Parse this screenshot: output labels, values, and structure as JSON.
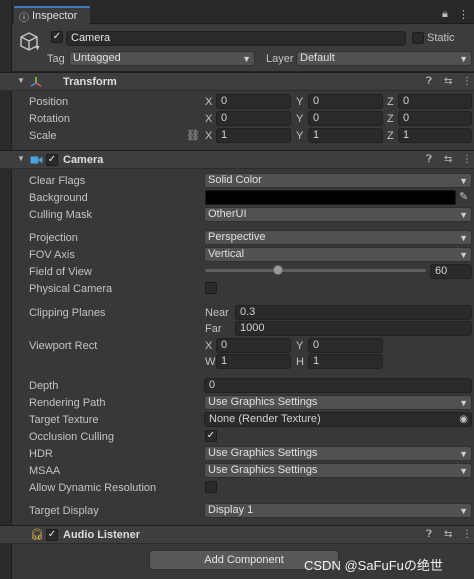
{
  "tab": {
    "title": "Inspector"
  },
  "object": {
    "name": "Camera",
    "static_label": "Static",
    "tag_label": "Tag",
    "tag_value": "Untagged",
    "layer_label": "Layer",
    "layer_value": "Default"
  },
  "transform": {
    "title": "Transform",
    "position_label": "Position",
    "rotation_label": "Rotation",
    "scale_label": "Scale",
    "x": "X",
    "y": "Y",
    "z": "Z",
    "position": [
      "0",
      "0",
      "0"
    ],
    "rotation": [
      "0",
      "0",
      "0"
    ],
    "scale": [
      "1",
      "1",
      "1"
    ]
  },
  "camera": {
    "title": "Camera",
    "clear_flags_label": "Clear Flags",
    "clear_flags": "Solid Color",
    "background_label": "Background",
    "background_color": "#000000",
    "culling_mask_label": "Culling Mask",
    "culling_mask": "OtherUI",
    "projection_label": "Projection",
    "projection": "Perspective",
    "fov_axis_label": "FOV Axis",
    "fov_axis": "Vertical",
    "fov_label": "Field of View",
    "fov": "60",
    "fov_fraction": 0.33,
    "physical_camera_label": "Physical Camera",
    "clipping_label": "Clipping Planes",
    "near_label": "Near",
    "near": "0.3",
    "far_label": "Far",
    "far": "1000",
    "viewport_label": "Viewport Rect",
    "vx": "0",
    "vy": "0",
    "vw": "1",
    "vh": "1",
    "vx_label": "X",
    "vy_label": "Y",
    "vw_label": "W",
    "vh_label": "H",
    "depth_label": "Depth",
    "depth": "0",
    "rendering_path_label": "Rendering Path",
    "rendering_path": "Use Graphics Settings",
    "target_texture_label": "Target Texture",
    "target_texture": "None (Render Texture)",
    "occlusion_label": "Occlusion Culling",
    "hdr_label": "HDR",
    "hdr": "Use Graphics Settings",
    "msaa_label": "MSAA",
    "msaa": "Use Graphics Settings",
    "dynamic_res_label": "Allow Dynamic Resolution",
    "target_display_label": "Target Display",
    "target_display": "Display 1"
  },
  "audio": {
    "title": "Audio Listener"
  },
  "add_component": "Add Component",
  "watermark": "CSDN @SaFuFuの绝世"
}
